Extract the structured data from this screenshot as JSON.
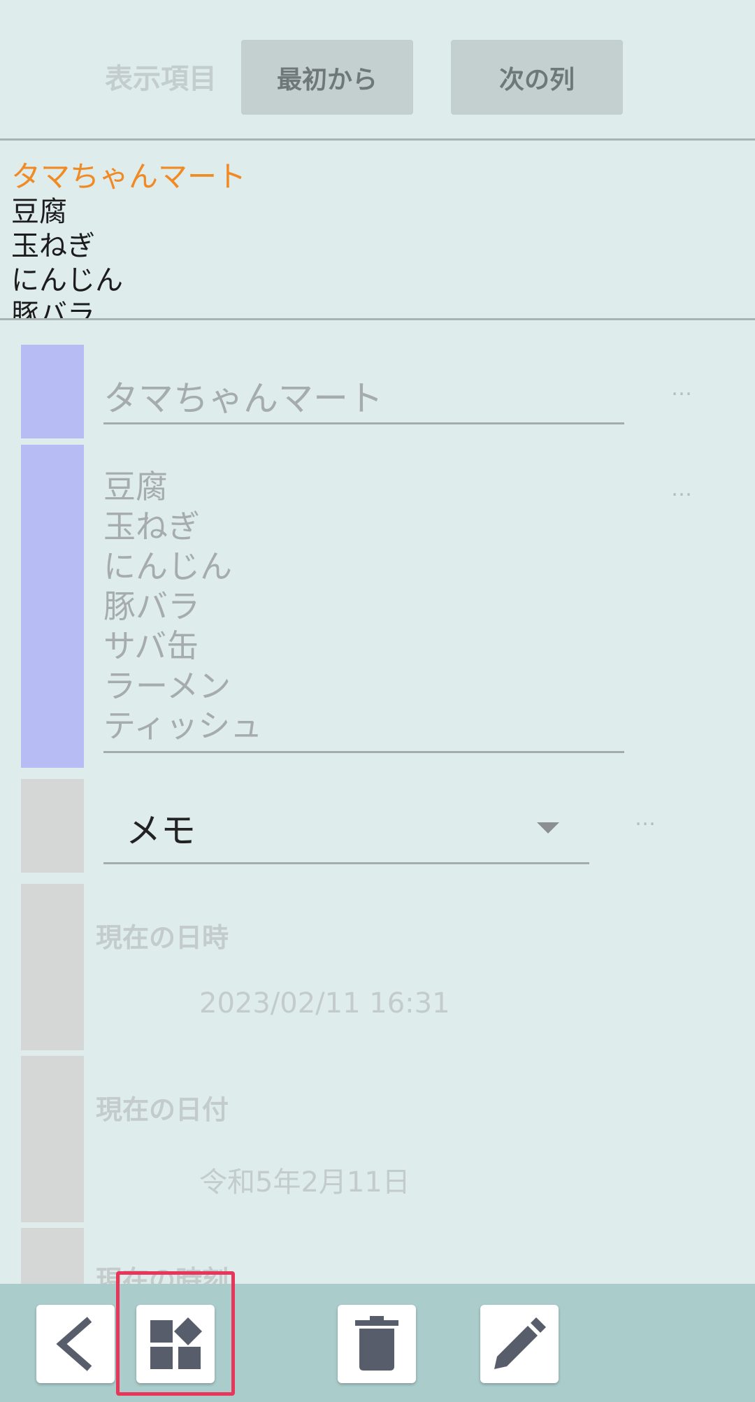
{
  "toolbar_top": {
    "label": "表示項目",
    "first_button": "最初から",
    "next_button": "次の列"
  },
  "preview": {
    "title": "タマちゃんマート",
    "body": "豆腐\n玉ねぎ\nにんじん\n豚バラ"
  },
  "fields": {
    "title_field": "タマちゃんマート",
    "items_field": "豆腐\n玉ねぎ\nにんじん\n豚バラ\nサバ缶\nラーメン\nティッシュ",
    "memo_dropdown": "メモ",
    "more": "…"
  },
  "sections": [
    {
      "label": "現在の日時",
      "value": "2023/02/11 16:31"
    },
    {
      "label": "現在の日付",
      "value": "令和5年2月11日"
    },
    {
      "label": "現在の時刻",
      "value": ""
    }
  ],
  "bottom_bar": {
    "icons": [
      "chevron-left-icon",
      "widgets-icon",
      "trash-icon",
      "pencil-icon"
    ]
  },
  "colors": {
    "accent_orange": "#f08a24",
    "bar_blue": "#b7bcf5",
    "highlight": "#e8355a",
    "bottom_bar": "#aacdcc"
  }
}
